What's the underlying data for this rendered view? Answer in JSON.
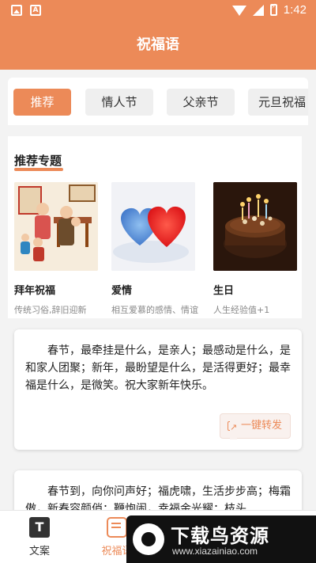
{
  "status_bar": {
    "time": "1:42"
  },
  "header": {
    "title": "祝福语"
  },
  "tabs": [
    {
      "label": "推荐",
      "active": true
    },
    {
      "label": "情人节",
      "active": false
    },
    {
      "label": "父亲节",
      "active": false
    },
    {
      "label": "元旦祝福",
      "active": false
    }
  ],
  "featured": {
    "title": "推荐专题",
    "cards": [
      {
        "name": "拜年祝福",
        "desc": "传统习俗,辞旧迎新",
        "image": "family-new-year-illustration"
      },
      {
        "name": "爱情",
        "desc": "相互爱慕的感情、情谊",
        "image": "two-hearts"
      },
      {
        "name": "生日",
        "desc": "人生经验值+1",
        "image": "birthday-cake-candles"
      }
    ]
  },
  "blessings": [
    {
      "text": "春节，最牵挂是什么，是亲人；最感动是什么，是和家人团聚；新年，最盼望是什么，是活得更好；最幸福是什么，是微笑。祝大家新年快乐。",
      "forward_label": "一键转发"
    },
    {
      "text": "春节到，向你问声好；福虎啸，生活步步高；梅霜傲，新春容颜俏；鞭炮闹，幸福金光耀；枝头"
    }
  ],
  "bottom_nav": [
    {
      "label": "文案",
      "icon": "text-doc-icon",
      "active": false
    },
    {
      "label": "祝福语",
      "icon": "chat-bubble-icon",
      "active": true
    }
  ],
  "watermark": {
    "title": "下载鸟资源",
    "url": "www.xiazainiao.com"
  },
  "colors": {
    "accent": "#ec8a58",
    "background": "#f3f3f3"
  }
}
